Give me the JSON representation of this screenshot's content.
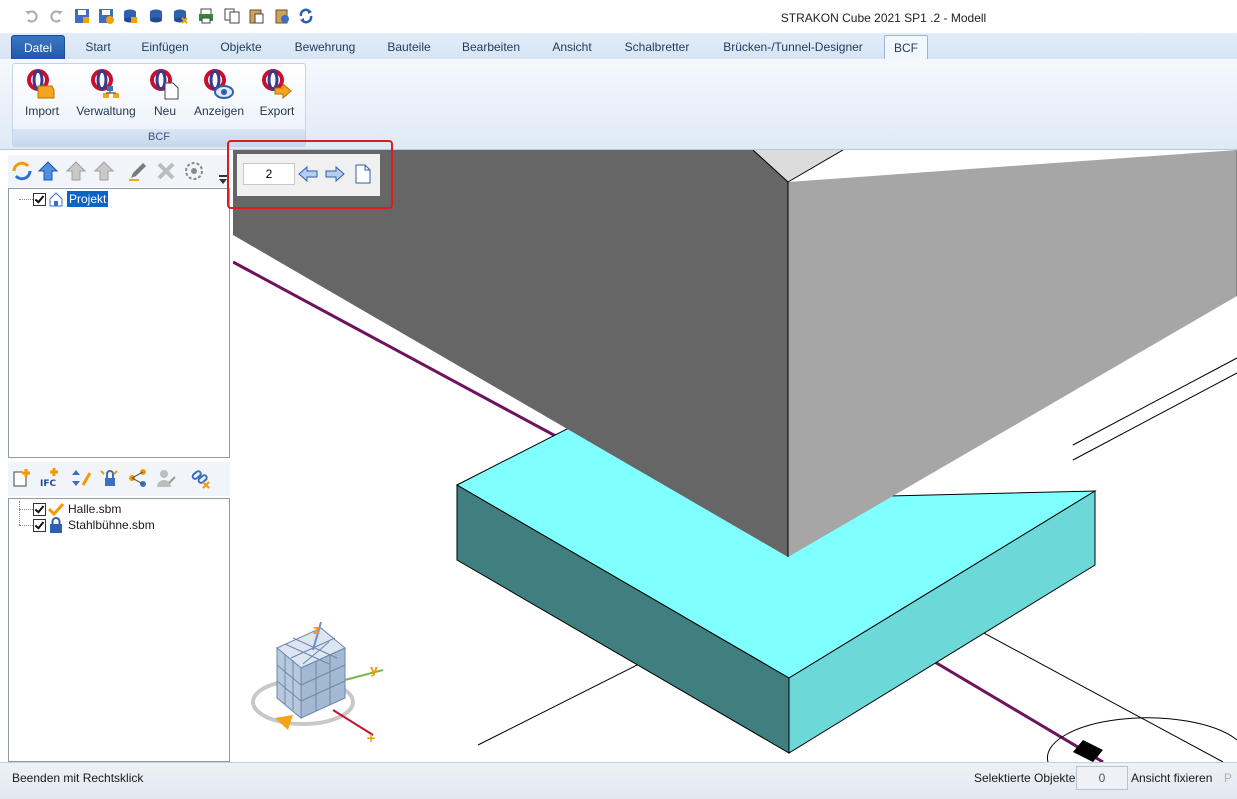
{
  "window": {
    "title": "STRAKON Cube 2021 SP1 .2 - Modell"
  },
  "ribbon": {
    "file_tab": "Datei",
    "tabs": [
      "Start",
      "Einfügen",
      "Objekte",
      "Bewehrung",
      "Bauteile",
      "Bearbeiten",
      "Ansicht",
      "Schalbretter",
      "Brücken-/Tunnel-Designer",
      "BCF"
    ],
    "active_tab": "BCF",
    "group": {
      "label": "BCF",
      "buttons": [
        {
          "label": "Import",
          "icon": "bcf-import-icon"
        },
        {
          "label": "Verwaltung",
          "icon": "bcf-manage-icon"
        },
        {
          "label": "Neu",
          "icon": "bcf-new-icon"
        },
        {
          "label": "Anzeigen",
          "icon": "bcf-view-icon"
        },
        {
          "label": "Export",
          "icon": "bcf-export-icon"
        }
      ]
    }
  },
  "project_tree": {
    "root": {
      "label": "Projekt",
      "checked": true,
      "selected": true
    }
  },
  "model_tree": {
    "items": [
      {
        "label": "Halle.sbm",
        "checked": true,
        "icon": "checkmark-icon"
      },
      {
        "label": "Stahlbühne.sbm",
        "checked": true,
        "icon": "lock-icon"
      }
    ]
  },
  "viewport": {
    "page_navigator": {
      "value": "2"
    },
    "colors": {
      "column_front": "#666666",
      "column_side": "#a6a6a6",
      "footing_top": "#80ffff",
      "footing_front": "#3f7f7f",
      "footing_side": "#6cd8d8",
      "axis_line": "#6e1360",
      "highlight": "#e01b1b"
    }
  },
  "statusbar": {
    "message": "Beenden mit Rechtsklick",
    "selected_label": "Selektierte Objekte",
    "selected_count": "0",
    "fix_view_label": "Ansicht fixieren",
    "trailing": "P"
  }
}
